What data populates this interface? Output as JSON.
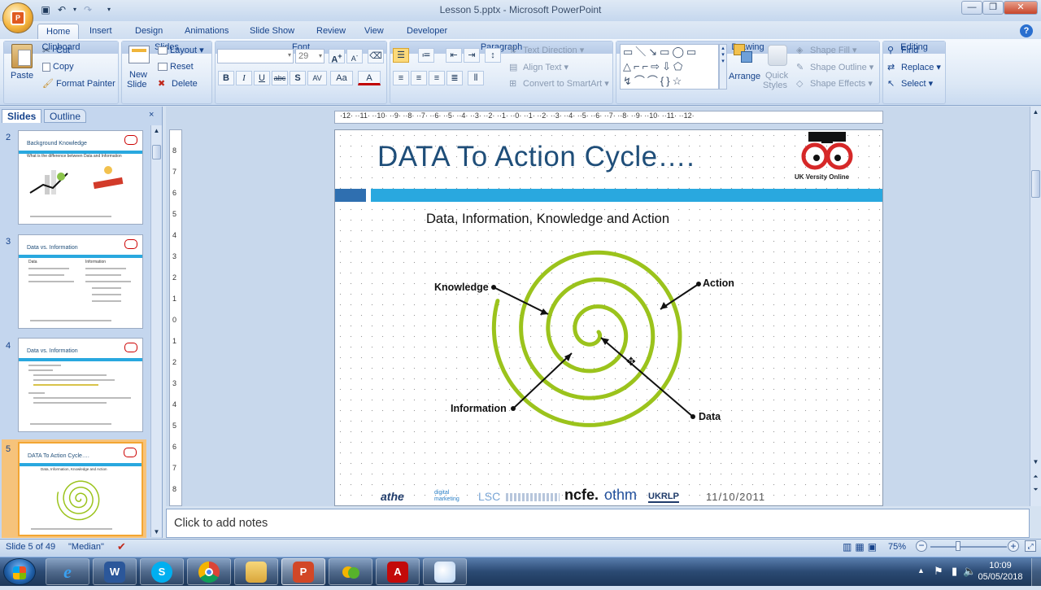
{
  "window": {
    "title": "Lesson 5.pptx - Microsoft PowerPoint"
  },
  "tabs": [
    "Home",
    "Insert",
    "Design",
    "Animations",
    "Slide Show",
    "Review",
    "View",
    "Developer"
  ],
  "ribbon": {
    "clipboard": {
      "label": "Clipboard",
      "paste": "Paste",
      "cut": "Cut",
      "copy": "Copy",
      "format_painter": "Format Painter"
    },
    "slides": {
      "label": "Slides",
      "new_slide_1": "New",
      "new_slide_2": "Slide",
      "layout": "Layout",
      "reset": "Reset",
      "delete": "Delete"
    },
    "font": {
      "label": "Font",
      "font_name": "",
      "font_size": "29",
      "bold": "B",
      "italic": "I",
      "underline": "U",
      "strike": "abc",
      "shadow": "S",
      "spacing": "AV",
      "case": "Aa",
      "color": "A"
    },
    "paragraph": {
      "label": "Paragraph",
      "text_direction": "Text Direction",
      "align_text": "Align Text",
      "convert_smartart": "Convert to SmartArt"
    },
    "drawing": {
      "label": "Drawing",
      "arrange": "Arrange",
      "quick_styles_1": "Quick",
      "quick_styles_2": "Styles",
      "shape_fill": "Shape Fill",
      "shape_outline": "Shape Outline",
      "shape_effects": "Shape Effects"
    },
    "editing": {
      "label": "Editing",
      "find": "Find",
      "replace": "Replace",
      "select": "Select"
    }
  },
  "panel": {
    "tab_slides": "Slides",
    "tab_outline": "Outline",
    "close": "×"
  },
  "thumbnails": [
    {
      "num": "2",
      "title": "Background Knowledge",
      "sub": "What is the difference between Data and Information"
    },
    {
      "num": "3",
      "title": "Data vs. Information",
      "col1": "Data",
      "col2": "Information"
    },
    {
      "num": "4",
      "title": "Data vs. Information"
    },
    {
      "num": "5",
      "title": "DATA To Action Cycle….",
      "sub": "Data, Information, Knowledge and Action"
    }
  ],
  "slide": {
    "title": "DATA To Action Cycle….",
    "subtitle": "Data, Information, Knowledge and Action",
    "logo_text": "UK Versity Online",
    "labels": {
      "knowledge": "Knowledge",
      "action": "Action",
      "information": "Information",
      "data": "Data"
    },
    "date": "11/10/2011",
    "footer_logos": [
      "athe",
      "digital marketing",
      "LSC",
      "ncfe.",
      "othm",
      "UKRLP"
    ]
  },
  "ruler": {
    "h_ticks": [
      "12",
      "11",
      "10",
      "9",
      "8",
      "7",
      "6",
      "5",
      "4",
      "3",
      "2",
      "1",
      "0",
      "1",
      "2",
      "3",
      "4",
      "5",
      "6",
      "7",
      "8",
      "9",
      "10",
      "11",
      "12"
    ]
  },
  "notes": {
    "placeholder": "Click to add notes"
  },
  "status": {
    "slide_of": "Slide 5 of 49",
    "theme": "\"Median\"",
    "zoom": "75%"
  },
  "taskbar": {
    "time": "10:09",
    "date": "05/05/2018"
  },
  "colors": {
    "accent": "#29a8df",
    "title": "#1f4e79",
    "spiral": "#9bc31c",
    "selection": "#f3a633"
  }
}
